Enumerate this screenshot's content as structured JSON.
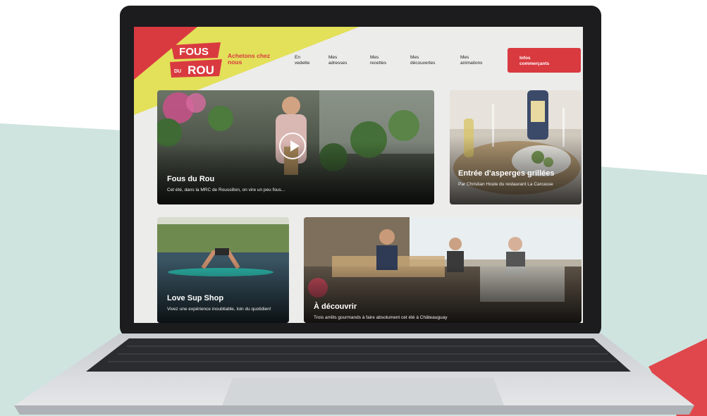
{
  "brand": {
    "logo_top": "FOUS",
    "logo_small": "DU",
    "logo_bottom": "ROU",
    "tagline": "Achetons chez nous",
    "accent_color": "#d93a40",
    "yellow_color": "#e3e05a"
  },
  "nav": {
    "items": [
      {
        "line1": "En",
        "line2": "vedette"
      },
      {
        "line1": "Mes",
        "line2": "adresses"
      },
      {
        "line1": "Mes",
        "line2": "recettes"
      },
      {
        "line1": "Mes",
        "line2": "découvertes"
      },
      {
        "line1": "Mes",
        "line2": "animations"
      }
    ],
    "cta": {
      "line1": "Infos",
      "line2": "commerçants"
    }
  },
  "cards": [
    {
      "title": "Fous du Rou",
      "subtitle": "Cet été, dans la MRC de Roussillon, on vire un peu fous...",
      "has_video": true
    },
    {
      "title": "Entrée d'asperges grillées",
      "subtitle": "Par Christian Houle du restaurant La Carcasse"
    },
    {
      "title": "Love Sup Shop",
      "subtitle": "Vivez une expérience inoubliable, loin du quotidien!"
    },
    {
      "title": "À découvrir",
      "subtitle": "Trois arrêts gourmands à faire absolument cet été à Châteauguay"
    }
  ]
}
